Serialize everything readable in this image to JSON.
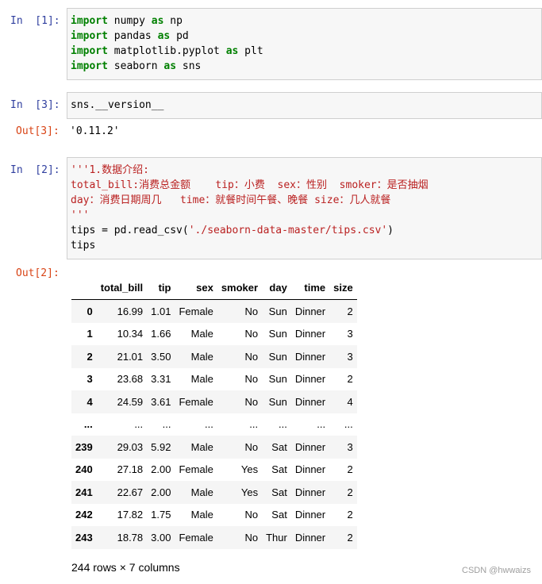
{
  "cells": [
    {
      "prompt": "In  [1]:",
      "lines": [
        [
          {
            "t": "import",
            "k": "kw"
          },
          {
            "t": " numpy "
          },
          {
            "t": "as",
            "k": "kw"
          },
          {
            "t": " np"
          }
        ],
        [
          {
            "t": "import",
            "k": "kw"
          },
          {
            "t": " pandas "
          },
          {
            "t": "as",
            "k": "kw"
          },
          {
            "t": " pd"
          }
        ],
        [
          {
            "t": "import",
            "k": "kw"
          },
          {
            "t": " matplotlib.pyplot "
          },
          {
            "t": "as",
            "k": "kw"
          },
          {
            "t": " plt"
          }
        ],
        [
          {
            "t": "import",
            "k": "kw"
          },
          {
            "t": " seaborn "
          },
          {
            "t": "as",
            "k": "kw"
          },
          {
            "t": " sns"
          }
        ]
      ]
    },
    {
      "prompt": "In  [3]:",
      "lines": [
        [
          {
            "t": "sns.__version__"
          }
        ]
      ],
      "out_prompt": "Out[3]:",
      "out_text": "'0.11.2'"
    },
    {
      "prompt": "In  [2]:",
      "lines": [
        [
          {
            "t": "'''1.数据介绍:",
            "k": "str"
          }
        ],
        [
          {
            "t": "total_bill:消费总金额    tip：小费  sex：性别  smoker：是否抽烟",
            "k": "str"
          }
        ],
        [
          {
            "t": "day：消费日期周几   time：就餐时间午餐、晚餐 size：几人就餐",
            "k": "str"
          }
        ],
        [
          {
            "t": "'''",
            "k": "str"
          }
        ],
        [
          {
            "t": "tips = pd.read_csv("
          },
          {
            "t": "'./seaborn-data-master/tips.csv'",
            "k": "str"
          },
          {
            "t": ")"
          }
        ],
        [
          {
            "t": "tips"
          }
        ]
      ],
      "out_prompt": "Out[2]:"
    }
  ],
  "dataframe": {
    "columns": [
      "",
      "total_bill",
      "tip",
      "sex",
      "smoker",
      "day",
      "time",
      "size"
    ],
    "rows": [
      [
        "0",
        "16.99",
        "1.01",
        "Female",
        "No",
        "Sun",
        "Dinner",
        "2"
      ],
      [
        "1",
        "10.34",
        "1.66",
        "Male",
        "No",
        "Sun",
        "Dinner",
        "3"
      ],
      [
        "2",
        "21.01",
        "3.50",
        "Male",
        "No",
        "Sun",
        "Dinner",
        "3"
      ],
      [
        "3",
        "23.68",
        "3.31",
        "Male",
        "No",
        "Sun",
        "Dinner",
        "2"
      ],
      [
        "4",
        "24.59",
        "3.61",
        "Female",
        "No",
        "Sun",
        "Dinner",
        "4"
      ],
      [
        "...",
        "...",
        "...",
        "...",
        "...",
        "...",
        "...",
        "..."
      ],
      [
        "239",
        "29.03",
        "5.92",
        "Male",
        "No",
        "Sat",
        "Dinner",
        "3"
      ],
      [
        "240",
        "27.18",
        "2.00",
        "Female",
        "Yes",
        "Sat",
        "Dinner",
        "2"
      ],
      [
        "241",
        "22.67",
        "2.00",
        "Male",
        "Yes",
        "Sat",
        "Dinner",
        "2"
      ],
      [
        "242",
        "17.82",
        "1.75",
        "Male",
        "No",
        "Sat",
        "Dinner",
        "2"
      ],
      [
        "243",
        "18.78",
        "3.00",
        "Female",
        "No",
        "Thur",
        "Dinner",
        "2"
      ]
    ],
    "footer": "244 rows × 7 columns"
  },
  "watermark": "CSDN @hwwaizs",
  "colors": {
    "in_prompt": "#303f9f",
    "out_prompt": "#d84315",
    "keyword": "#008000",
    "string": "#ba2121"
  }
}
